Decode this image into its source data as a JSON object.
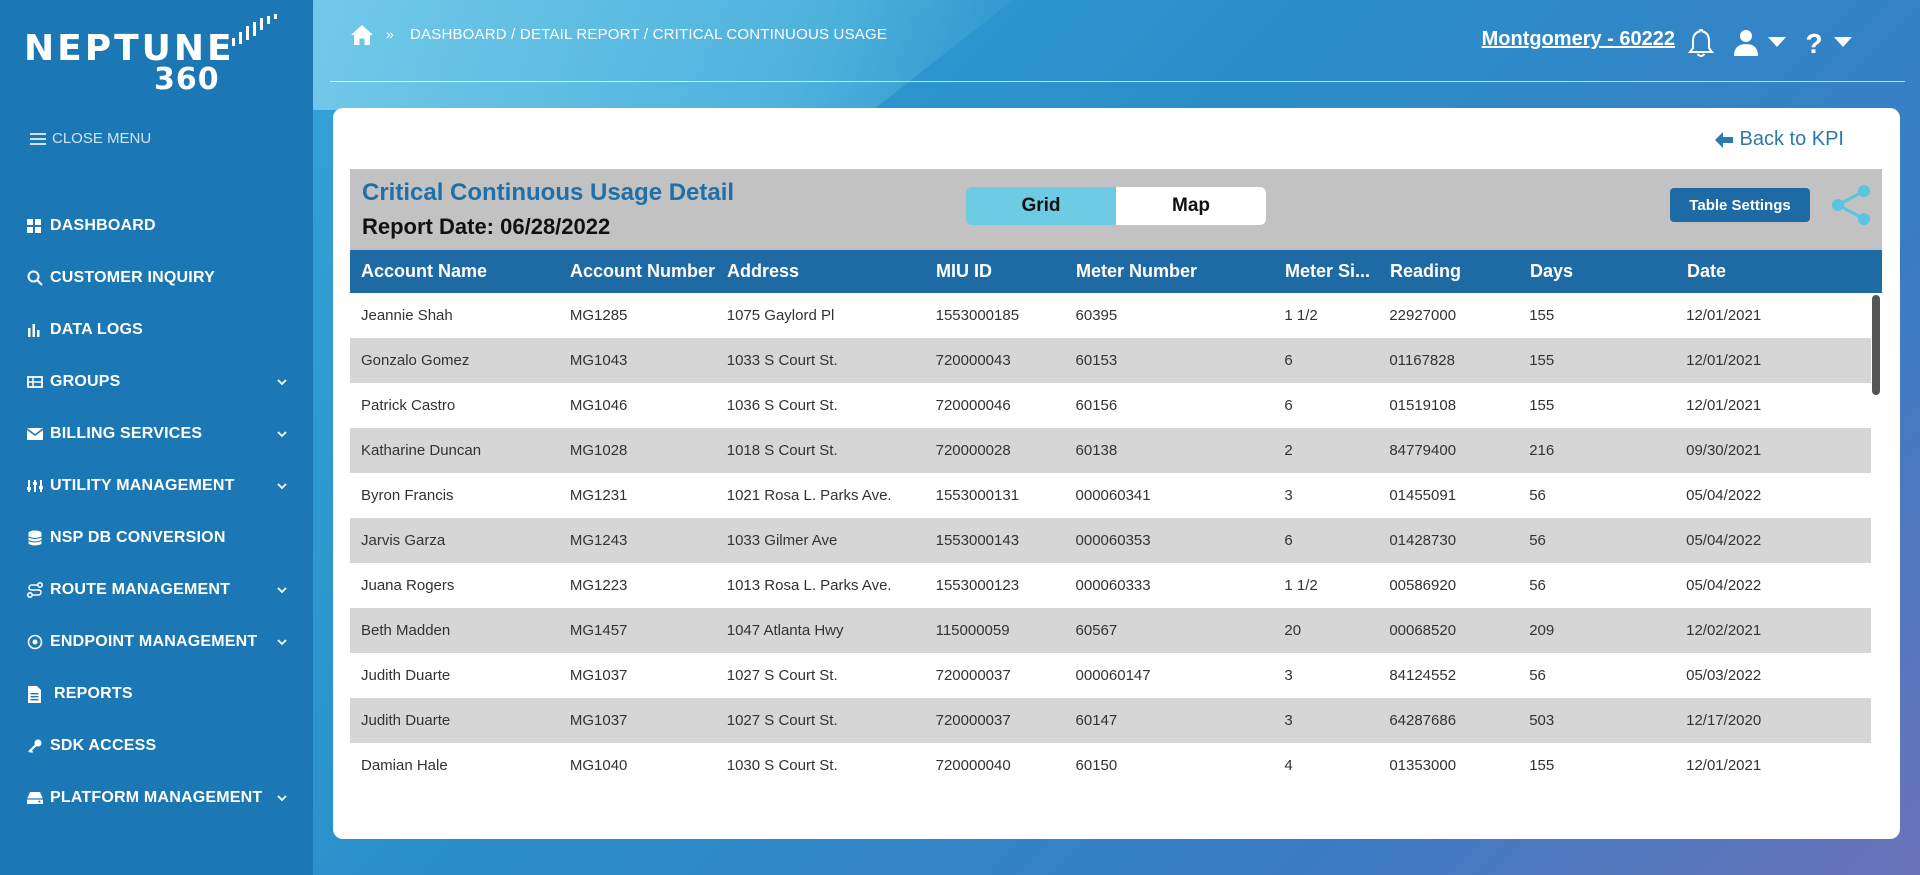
{
  "brand": {
    "name": "NEPTUNE",
    "sub": "360"
  },
  "sidebar": {
    "close_menu": "CLOSE MENU",
    "items": [
      {
        "label": "DASHBOARD",
        "icon": "grid-icon",
        "has_chevron": false
      },
      {
        "label": "CUSTOMER INQUIRY",
        "icon": "search-icon",
        "has_chevron": false
      },
      {
        "label": "DATA LOGS",
        "icon": "bar-chart-icon",
        "has_chevron": false
      },
      {
        "label": "GROUPS",
        "icon": "groups-icon",
        "has_chevron": true
      },
      {
        "label": "BILLING SERVICES",
        "icon": "envelope-icon",
        "has_chevron": true
      },
      {
        "label": "UTILITY MANAGEMENT",
        "icon": "sliders-icon",
        "has_chevron": true
      },
      {
        "label": "NSP DB CONVERSION",
        "icon": "database-icon",
        "has_chevron": false
      },
      {
        "label": "ROUTE MANAGEMENT",
        "icon": "route-icon",
        "has_chevron": true
      },
      {
        "label": "ENDPOINT MANAGEMENT",
        "icon": "target-icon",
        "has_chevron": true
      },
      {
        "label": "REPORTS",
        "icon": "document-icon",
        "has_chevron": false
      },
      {
        "label": "SDK ACCESS",
        "icon": "key-icon",
        "has_chevron": false
      },
      {
        "label": "PLATFORM MANAGEMENT",
        "icon": "drive-icon",
        "has_chevron": true
      }
    ]
  },
  "header": {
    "breadcrumb": "DASHBOARD / DETAIL REPORT / CRITICAL CONTINUOUS USAGE",
    "location": "Montgomery - 60222"
  },
  "report": {
    "back_label": "Back to KPI",
    "title": "Critical Continuous Usage Detail",
    "date": "Report Date: 06/28/2022",
    "view_grid": "Grid",
    "view_map": "Map",
    "table_settings": "Table Settings",
    "columns": [
      "Account Name",
      "Account Number",
      "Address",
      "MIU ID",
      "Meter Number",
      "Meter Si...",
      "Reading",
      "Days",
      "Date"
    ],
    "rows": [
      [
        "Jeannie Shah",
        "MG1285",
        "1075 Gaylord Pl",
        "1553000185",
        "60395",
        "1 1/2",
        "22927000",
        "155",
        "12/01/2021"
      ],
      [
        "Gonzalo Gomez",
        "MG1043",
        "1033 S Court St.",
        "720000043",
        "60153",
        "6",
        "01167828",
        "155",
        "12/01/2021"
      ],
      [
        "Patrick Castro",
        "MG1046",
        "1036 S Court St.",
        "720000046",
        "60156",
        "6",
        "01519108",
        "155",
        "12/01/2021"
      ],
      [
        "Katharine Duncan",
        "MG1028",
        "1018 S Court St.",
        "720000028",
        "60138",
        "2",
        "84779400",
        "216",
        "09/30/2021"
      ],
      [
        "Byron Francis",
        "MG1231",
        "1021 Rosa L. Parks Ave.",
        "1553000131",
        "000060341",
        "3",
        "01455091",
        "56",
        "05/04/2022"
      ],
      [
        "Jarvis Garza",
        "MG1243",
        "1033 Gilmer Ave",
        "1553000143",
        "000060353",
        "6",
        "01428730",
        "56",
        "05/04/2022"
      ],
      [
        "Juana Rogers",
        "MG1223",
        "1013 Rosa L. Parks Ave.",
        "1553000123",
        "000060333",
        "1 1/2",
        "00586920",
        "56",
        "05/04/2022"
      ],
      [
        "Beth Madden",
        "MG1457",
        "1047 Atlanta Hwy",
        "115000059",
        "60567",
        "20",
        "00068520",
        "209",
        "12/02/2021"
      ],
      [
        "Judith Duarte",
        "MG1037",
        "1027 S Court St.",
        "720000037",
        "000060147",
        "3",
        "84124552",
        "56",
        "05/03/2022"
      ],
      [
        "Judith Duarte",
        "MG1037",
        "1027 S Court St.",
        "720000037",
        "60147",
        "3",
        "64287686",
        "503",
        "12/17/2020"
      ],
      [
        "Damian Hale",
        "MG1040",
        "1030 S Court St.",
        "720000040",
        "60150",
        "4",
        "01353000",
        "155",
        "12/01/2021"
      ]
    ]
  }
}
